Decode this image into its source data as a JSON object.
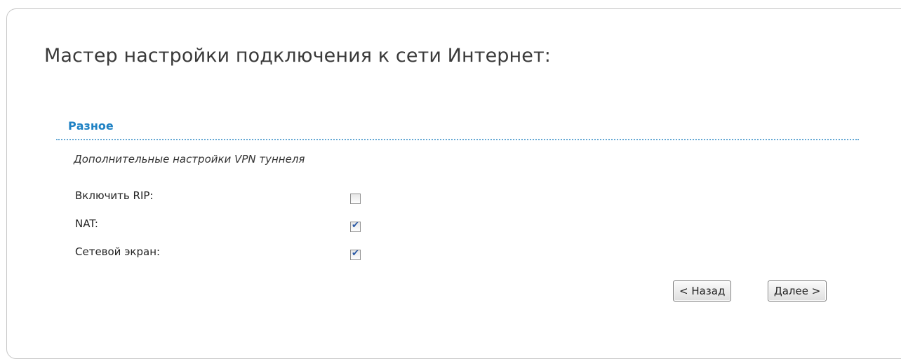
{
  "wizard": {
    "title": "Мастер настройки подключения к сети Интернет:"
  },
  "section": {
    "title": "Разное",
    "description": "Дополнительные настройки VPN туннеля",
    "fields": [
      {
        "label": "Включить RIP:",
        "checked": false
      },
      {
        "label": "NAT:",
        "checked": true
      },
      {
        "label": "Сетевой экран:",
        "checked": true
      }
    ]
  },
  "buttons": {
    "back_label": "< Назад",
    "next_label": "Далее >"
  },
  "icons": {
    "checkmark": "checkmark-icon"
  },
  "colors": {
    "section_title": "#1f82c4",
    "divider": "#64a8d4",
    "check": "#2b5aa6"
  }
}
